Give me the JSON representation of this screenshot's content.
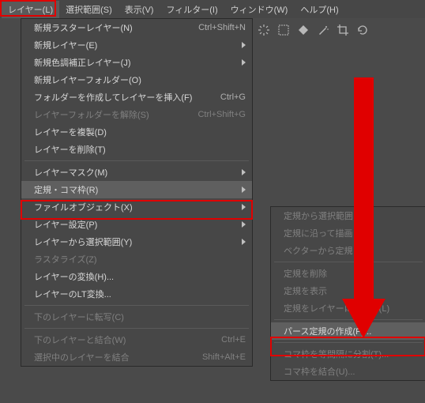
{
  "menubar": {
    "items": [
      {
        "label": "レイヤー(L)",
        "active": true
      },
      {
        "label": "選択範囲(S)"
      },
      {
        "label": "表示(V)"
      },
      {
        "label": "フィルター(I)"
      },
      {
        "label": "ウィンドウ(W)"
      },
      {
        "label": "ヘルプ(H)"
      }
    ]
  },
  "main_menu": [
    {
      "label": "新規ラスターレイヤー(N)",
      "shortcut": "Ctrl+Shift+N"
    },
    {
      "label": "新規レイヤー(E)",
      "submenu": true
    },
    {
      "label": "新規色調補正レイヤー(J)",
      "submenu": true
    },
    {
      "label": "新規レイヤーフォルダー(O)"
    },
    {
      "label": "フォルダーを作成してレイヤーを挿入(F)",
      "shortcut": "Ctrl+G"
    },
    {
      "label": "レイヤーフォルダーを解除(S)",
      "shortcut": "Ctrl+Shift+G",
      "disabled": true
    },
    {
      "label": "レイヤーを複製(D)"
    },
    {
      "label": "レイヤーを削除(T)"
    },
    {
      "sep": true
    },
    {
      "label": "レイヤーマスク(M)",
      "submenu": true
    },
    {
      "label": "定規・コマ枠(R)",
      "submenu": true,
      "hover": true
    },
    {
      "label": "ファイルオブジェクト(X)",
      "submenu": true
    },
    {
      "label": "レイヤー設定(P)",
      "submenu": true
    },
    {
      "label": "レイヤーから選択範囲(Y)",
      "submenu": true
    },
    {
      "label": "ラスタライズ(Z)",
      "disabled": true
    },
    {
      "label": "レイヤーの変換(H)..."
    },
    {
      "label": "レイヤーのLT変換..."
    },
    {
      "sep": true
    },
    {
      "label": "下のレイヤーに転写(C)",
      "shortcut": "",
      "disabled": true
    },
    {
      "sep": true
    },
    {
      "label": "下のレイヤーと結合(W)",
      "shortcut": "Ctrl+E",
      "disabled": true
    },
    {
      "label": "選択中のレイヤーを結合",
      "shortcut": "Shift+Alt+E",
      "disabled": true
    }
  ],
  "sub_menu": [
    {
      "label": "定規から選択範囲",
      "disabled": true
    },
    {
      "label": "定規に沿って描画",
      "disabled": true
    },
    {
      "label": "ベクターから定規",
      "disabled": true
    },
    {
      "sep": true
    },
    {
      "label": "定規を削除",
      "disabled": true
    },
    {
      "label": "定規を表示",
      "disabled": true
    },
    {
      "label": "定規をレイヤーにリンク(L)",
      "disabled": true
    },
    {
      "sep": true
    },
    {
      "label": "パース定規の作成(P)...",
      "hover": true
    },
    {
      "sep": true
    },
    {
      "label": "コマ枠を等間隔に分割(T)...",
      "disabled": true
    },
    {
      "label": "コマ枠を結合(U)...",
      "disabled": true
    }
  ],
  "icons": [
    "spinner",
    "dashed-rect",
    "diamond",
    "wand",
    "crop",
    "rotate"
  ]
}
